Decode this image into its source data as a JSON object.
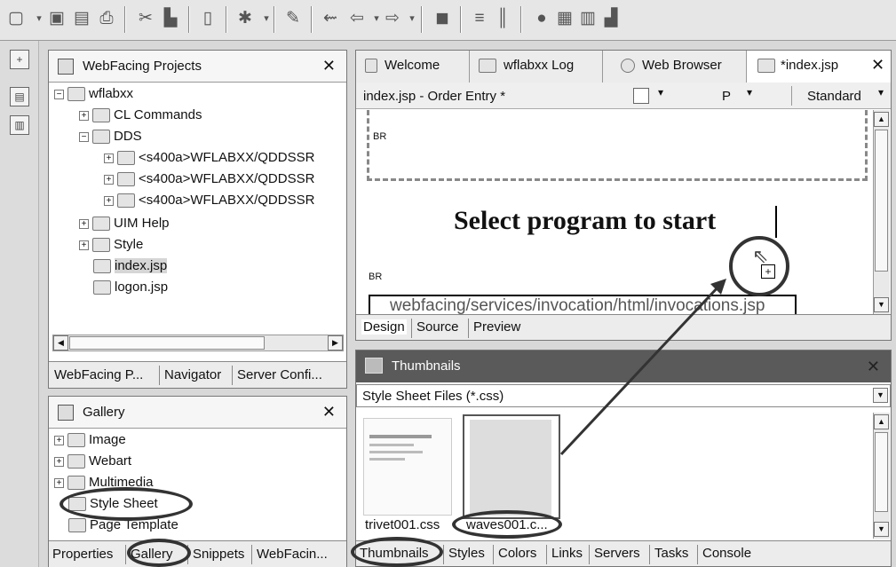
{
  "projects": {
    "title": "WebFacing Projects",
    "tree": [
      {
        "label": "wflabxx"
      },
      {
        "label": "CL Commands"
      },
      {
        "label": "DDS"
      },
      {
        "label": "<s400a>WFLABXX/QDDSSR"
      },
      {
        "label": "<s400a>WFLABXX/QDDSSR"
      },
      {
        "label": "<s400a>WFLABXX/QDDSSR"
      },
      {
        "label": "UIM Help"
      },
      {
        "label": "Style"
      },
      {
        "label": "index.jsp"
      },
      {
        "label": "logon.jsp"
      }
    ],
    "tabs": [
      "WebFacing P...",
      "Navigator",
      "Server Confi..."
    ]
  },
  "gallery": {
    "title": "Gallery",
    "items": [
      "Image",
      "Webart",
      "Multimedia",
      "Style Sheet",
      "Page Template"
    ],
    "tabs": [
      "Properties",
      "Gallery",
      "Snippets",
      "WebFacin..."
    ]
  },
  "editor": {
    "tabs": [
      "Welcome",
      "wflabxx Log",
      "Web Browser",
      "*index.jsp"
    ],
    "header": "index.jsp - Order Entry *",
    "header_p": "P",
    "header_mode": "Standard",
    "br1": "BR",
    "heading": "Select program to start",
    "br2": "BR",
    "url": "webfacing/services/invocation/html/invocations.jsp",
    "bottom_tabs": [
      "Design",
      "Source",
      "Preview"
    ]
  },
  "thumbnails": {
    "title": "Thumbnails",
    "filter": "Style Sheet Files (*.css)",
    "files": [
      "trivet001.css",
      "waves001.c..."
    ],
    "tabs": [
      "Thumbnails",
      "Styles",
      "Colors",
      "Links",
      "Servers",
      "Tasks",
      "Console"
    ]
  }
}
